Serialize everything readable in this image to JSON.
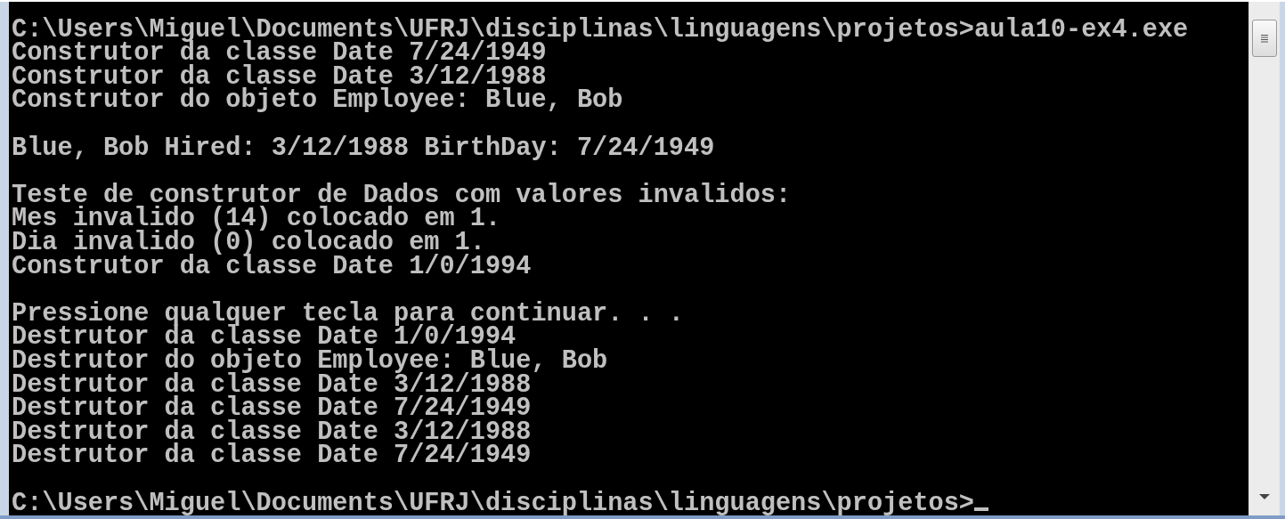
{
  "console": {
    "blocks": [
      [
        "C:\\Users\\Miguel\\Documents\\UFRJ\\disciplinas\\linguagens\\projetos>aula10-ex4.exe",
        "Construtor da classe Date 7/24/1949",
        "Construtor da classe Date 3/12/1988",
        "Construtor do objeto Employee: Blue, Bob"
      ],
      [
        "Blue, Bob Hired: 3/12/1988 BirthDay: 7/24/1949"
      ],
      [
        "Teste de construtor de Dados com valores invalidos:",
        "Mes invalido (14) colocado em 1.",
        "Dia invalido (0) colocado em 1.",
        "Construtor da classe Date 1/0/1994"
      ],
      [
        "Pressione qualquer tecla para continuar. . .",
        "Destrutor da classe Date 1/0/1994",
        "Destrutor do objeto Employee: Blue, Bob",
        "Destrutor da classe Date 3/12/1988",
        "Destrutor da classe Date 7/24/1949",
        "Destrutor da classe Date 3/12/1988",
        "Destrutor da classe Date 7/24/1949"
      ],
      [
        "C:\\Users\\Miguel\\Documents\\UFRJ\\disciplinas\\linguagens\\projetos>"
      ]
    ],
    "cursor": true
  }
}
